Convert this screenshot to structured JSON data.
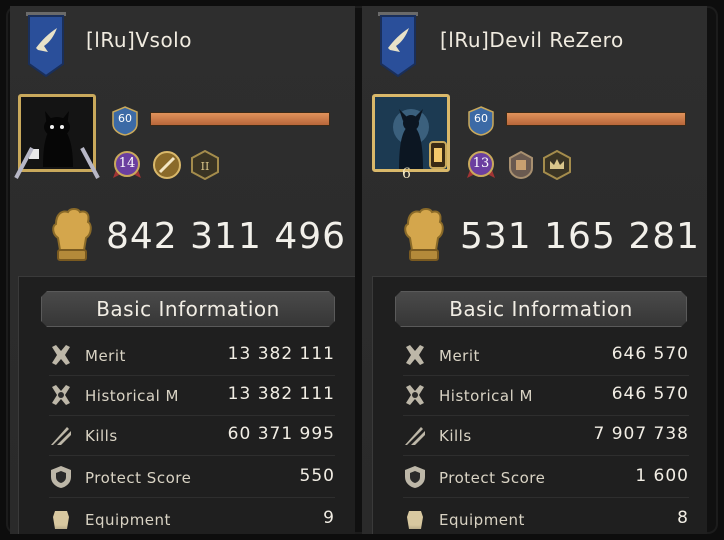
{
  "players": [
    {
      "name": "[lRu]Vsolo",
      "level": "60",
      "xp_progress": 1.0,
      "rank_medal": "14",
      "power": "842 311 496",
      "info_title": "Basic Information",
      "stats": [
        {
          "icon": "merit-icon",
          "label": "Merit",
          "value": "13 382 111"
        },
        {
          "icon": "historical-merit-icon",
          "label": "Historical M",
          "value": "13 382 111"
        },
        {
          "icon": "kills-icon",
          "label": "Kills",
          "value": "60 371 995"
        },
        {
          "icon": "protect-shield-icon",
          "label": "Protect Score",
          "value": "550"
        },
        {
          "icon": "equipment-icon",
          "label": "Equipment",
          "value": "9"
        }
      ]
    },
    {
      "name": "[lRu]Devil ReZero",
      "level": "60",
      "xp_progress": 1.0,
      "rank_medal": "13",
      "avatar_badge": "6",
      "power": "531 165 281",
      "info_title": "Basic Information",
      "stats": [
        {
          "icon": "merit-icon",
          "label": "Merit",
          "value": "646 570"
        },
        {
          "icon": "historical-merit-icon",
          "label": "Historical M",
          "value": "646 570"
        },
        {
          "icon": "kills-icon",
          "label": "Kills",
          "value": "7 907 738"
        },
        {
          "icon": "protect-shield-icon",
          "label": "Protect Score",
          "value": "1 600"
        },
        {
          "icon": "equipment-icon",
          "label": "Equipment",
          "value": "8"
        }
      ]
    }
  ],
  "colors": {
    "banner": "#2a4f9a",
    "xp_bar": "#d98a4e",
    "gold": "#c9a95c",
    "medal": "#6b3fa0"
  }
}
